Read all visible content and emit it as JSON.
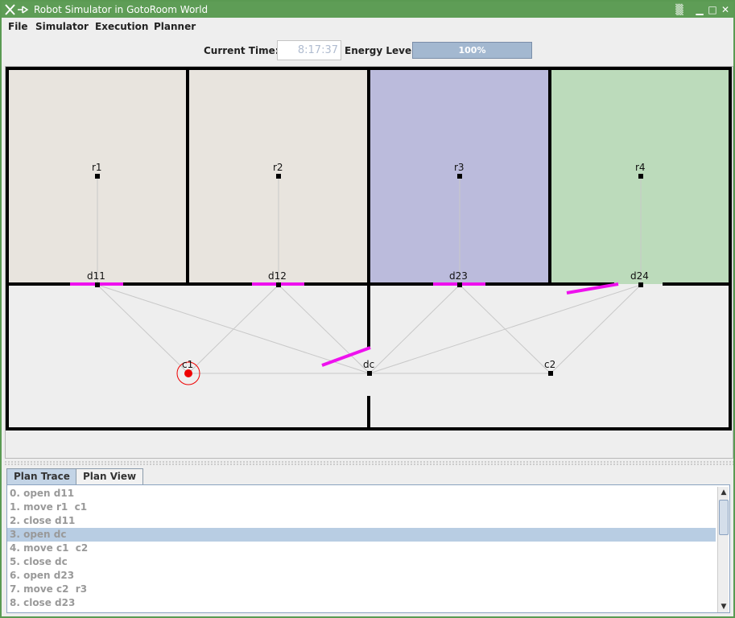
{
  "window": {
    "title": "Robot Simulator in GotoRoom World",
    "titlebar_color": "#5e9d56"
  },
  "menubar": {
    "items": [
      "File",
      "Simulator",
      "Execution",
      "Planner"
    ]
  },
  "toolbar": {
    "current_time_label": "Current Time:",
    "current_time_value": "8:17:37",
    "energy_label": "Energy Level",
    "energy_value": "100%",
    "energy_fraction": 1.0
  },
  "world": {
    "room_colors": {
      "r1": "#e8e4de",
      "r2": "#e8e4de",
      "r3": "#bbbbdc",
      "r4": "#bcdbbb",
      "corridor": "#eeeeee"
    },
    "door_color": "#ee11ee",
    "robot_color": "#ee0000",
    "nodes": [
      "r1",
      "r2",
      "r3",
      "r4",
      "d11",
      "d12",
      "d23",
      "d24",
      "c1",
      "dc",
      "c2"
    ],
    "robot_at": "c1"
  },
  "tabs": [
    {
      "label": "Plan Trace",
      "active": true
    },
    {
      "label": "Plan View",
      "active": false
    }
  ],
  "plan_trace": {
    "items": [
      "0. open d11",
      "1. move r1  c1",
      "2. close d11",
      "3. open dc",
      "4. move c1  c2",
      "5. close dc",
      "6. open d23",
      "7. move c2  r3",
      "8. close d23"
    ],
    "selected_index": 3
  }
}
